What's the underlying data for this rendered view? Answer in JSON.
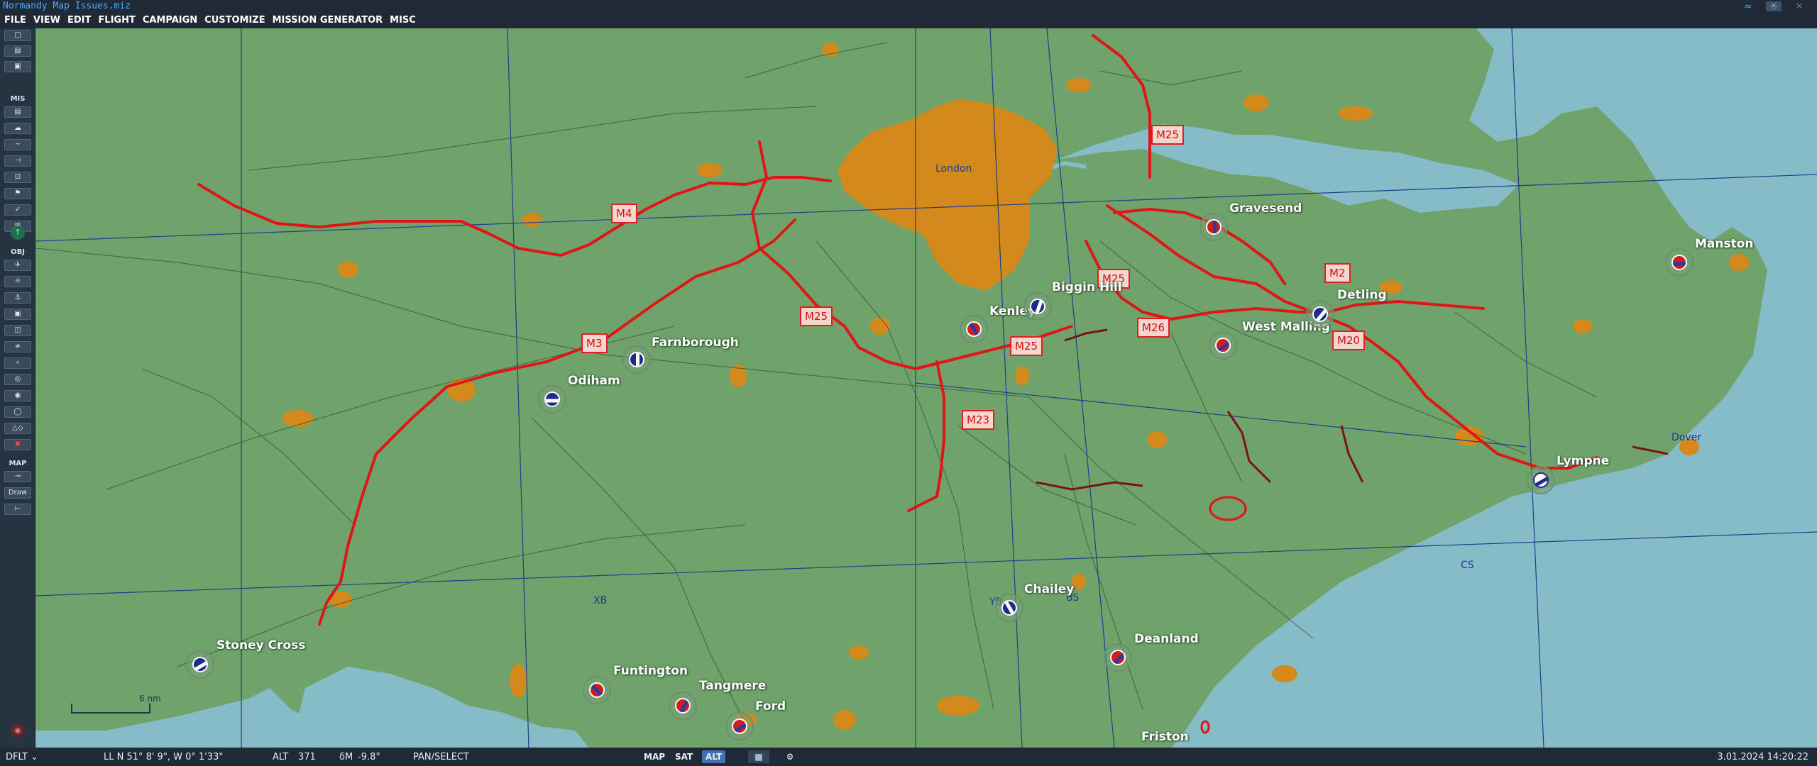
{
  "window": {
    "title": "Normandy Map Issues.miz"
  },
  "menu": {
    "items": [
      "FILE",
      "VIEW",
      "EDIT",
      "FLIGHT",
      "CAMPAIGN",
      "CUSTOMIZE",
      "MISSION GENERATOR",
      "MISC"
    ]
  },
  "sidebar": {
    "mis_label": "MIS",
    "obj_label": "OBJ",
    "map_label": "MAP",
    "draw_label": "Draw"
  },
  "map": {
    "airports": [
      {
        "name": "Farnborough",
        "coalition": "blue"
      },
      {
        "name": "Odiham",
        "coalition": "blue"
      },
      {
        "name": "Kenley",
        "coalition": "red"
      },
      {
        "name": "Biggin Hill",
        "coalition": "blue"
      },
      {
        "name": "Gravesend",
        "coalition": "red"
      },
      {
        "name": "West Malling",
        "coalition": "red"
      },
      {
        "name": "Detling",
        "coalition": "blue"
      },
      {
        "name": "Manston",
        "coalition": "red"
      },
      {
        "name": "Lympne",
        "coalition": "blue"
      },
      {
        "name": "Chailey",
        "coalition": "blue"
      },
      {
        "name": "Deanland",
        "coalition": "red"
      },
      {
        "name": "Stoney Cross",
        "coalition": "blue"
      },
      {
        "name": "Funtington",
        "coalition": "red"
      },
      {
        "name": "Tangmere",
        "coalition": "red"
      },
      {
        "name": "Ford",
        "coalition": "red"
      },
      {
        "name": "Friston",
        "coalition": "red"
      }
    ],
    "labels": {
      "london": "London",
      "dover": "Dover",
      "grid_xb": "XB",
      "grid_yb": "YB",
      "grid_bs": "BS",
      "grid_cs": "CS",
      "m4": "M4",
      "m3": "M3",
      "m25_north": "M25",
      "m25_west": "M25",
      "m25_east": "M25",
      "m25_south": "M25",
      "m23": "M23",
      "m26": "M26",
      "m2": "M2",
      "m20": "M20"
    },
    "scale_label": "6 nm",
    "colors": {
      "land": "#6fa36b",
      "sea": "#86bcc8",
      "urban": "#d48a1a",
      "motorway": "#e01515",
      "grid": "#1d3f8c"
    }
  },
  "status": {
    "profile": "DFLT",
    "coords": "LL  N 51° 8' 9\",  W  0° 1'33\"",
    "alt_label": "ALT",
    "alt_value": "371",
    "dm_label": "δM",
    "dm_value": "-9.8°",
    "mode": "PAN/SELECT",
    "map_btn": "MAP",
    "sat_btn": "SAT",
    "alt_btn": "ALT",
    "datetime": "3.01.2024 14:20:22"
  }
}
